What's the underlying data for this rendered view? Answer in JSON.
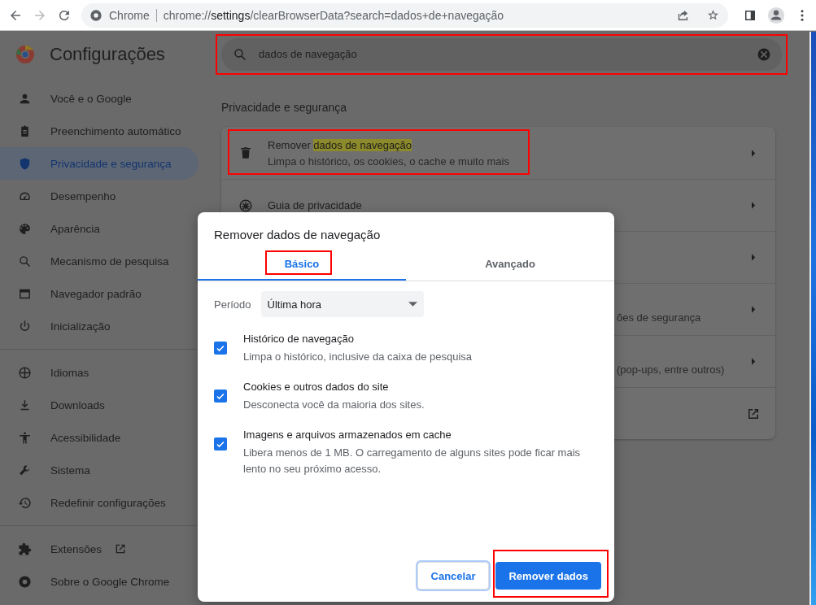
{
  "toolbar": {
    "forward_disabled": true,
    "site_label": "Chrome",
    "url": "chrome://**settings**/clearBrowserData?search=dados+de+navegação"
  },
  "header": {
    "title": "Configurações"
  },
  "search": {
    "value": "dados de navegação",
    "annotated": true
  },
  "sidebar": {
    "sections": [
      {
        "items": [
          {
            "label": "Você e o Google",
            "selected": false,
            "kind": "page"
          },
          {
            "label": "Preenchimento automático",
            "selected": false,
            "kind": "page"
          },
          {
            "label": "Privacidade e segurança",
            "selected": true,
            "kind": "page"
          },
          {
            "label": "Desempenho",
            "selected": false,
            "kind": "page"
          },
          {
            "label": "Aparência",
            "selected": false,
            "kind": "page"
          },
          {
            "label": "Mecanismo de pesquisa",
            "selected": false,
            "kind": "page"
          },
          {
            "label": "Navegador padrão",
            "selected": false,
            "kind": "page"
          },
          {
            "label": "Inicialização",
            "selected": false,
            "kind": "page"
          }
        ]
      },
      {
        "items": [
          {
            "label": "Idiomas",
            "selected": false,
            "kind": "page"
          },
          {
            "label": "Downloads",
            "selected": false,
            "kind": "page"
          },
          {
            "label": "Acessibilidade",
            "selected": false,
            "kind": "page"
          },
          {
            "label": "Sistema",
            "selected": false,
            "kind": "page"
          },
          {
            "label": "Redefinir configurações",
            "selected": false,
            "kind": "page"
          }
        ]
      },
      {
        "items": [
          {
            "label": "Extensões",
            "selected": false,
            "kind": "external"
          },
          {
            "label": "Sobre o Google Chrome",
            "selected": false,
            "kind": "page"
          }
        ]
      }
    ]
  },
  "section": {
    "heading": "Privacidade e segurança",
    "rows": [
      {
        "kind": "trash",
        "title": "Remover **dados de navegação**",
        "subtitle": "Limpa o histórico, os cookies, o cache e muito mais",
        "annotated": true,
        "external_link": false
      },
      {
        "kind": "guide",
        "title": "Guia de privacidade",
        "annotated": false,
        "external_link": false
      },
      {
        "kind": "covered",
        "annotated": false,
        "external_link": false
      },
      {
        "kind": "covered",
        "subtitle": "ões de segurança",
        "annotated": false,
        "external_link": false
      },
      {
        "kind": "covered",
        "subtitle": "(pop-ups, entre outros)",
        "annotated": false,
        "external_link": false
      },
      {
        "kind": "covered",
        "annotated": false,
        "external_link": true
      }
    ]
  },
  "dialog": {
    "title": "Remover dados de navegação",
    "tabs": [
      {
        "label": "Básico",
        "selected": true,
        "annotated": true
      },
      {
        "label": "Avançado",
        "selected": false,
        "annotated": false
      }
    ],
    "period": {
      "label": "Período",
      "value": "Última hora"
    },
    "options": [
      {
        "title": "Histórico de navegação",
        "description": "Limpa o histórico, inclusive da caixa de pesquisa",
        "checked": true
      },
      {
        "title": "Cookies e outros dados do site",
        "description": "Desconecta você da maioria dos sites.",
        "checked": true
      },
      {
        "title": "Imagens e arquivos armazenados em cache",
        "description": "Libera menos de 1 MB. O carregamento de alguns sites pode ficar mais lento no seu próximo acesso.",
        "checked": true
      }
    ],
    "buttons": [
      {
        "label": "Cancelar",
        "kind": "secondary",
        "focused": true,
        "annotated": false
      },
      {
        "label": "Remover dados",
        "kind": "primary",
        "focused": false,
        "annotated": true
      }
    ]
  }
}
